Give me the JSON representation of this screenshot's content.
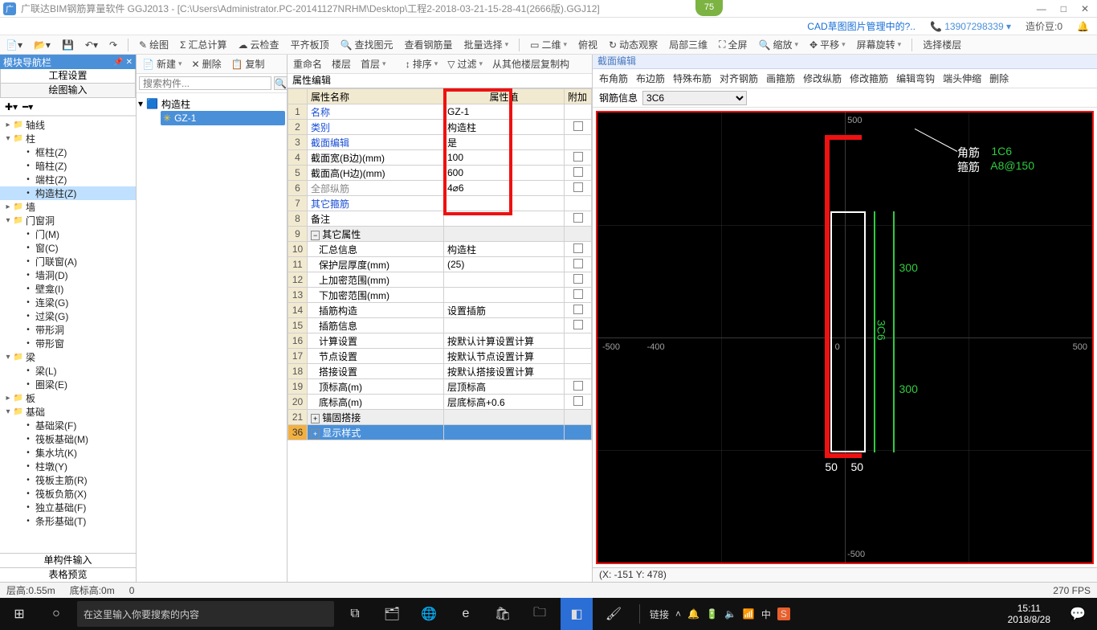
{
  "titlebar": {
    "app_icon_letter": "广",
    "title": "广联达BIM钢筋算量软件 GGJ2013 - [C:\\Users\\Administrator.PC-20141127NRHM\\Desktop\\工程2-2018-03-21-15-28-41(2666版).GGJ12]",
    "min": "—",
    "max": "□",
    "close": "✕"
  },
  "badge75": "75",
  "infobar": {
    "cad": "CAD草图图片管理中的?..",
    "phone": "13907298339",
    "cost": "造价豆:0"
  },
  "toolbar1": [
    "绘图",
    "汇总计算",
    "云检查",
    "平齐板顶",
    "查找图元",
    "查看钢筋量",
    "批量选择"
  ],
  "toolbar1b": [
    "二维",
    "俯视",
    "动态观察",
    "局部三维",
    "全屏",
    "缩放",
    "平移",
    "屏幕旋转",
    "选择楼层"
  ],
  "nav": {
    "title": "模块导航栏",
    "tabs": {
      "a": "工程设置",
      "b": "绘图输入"
    },
    "tree": [
      {
        "t": "▸",
        "d": 0,
        "ic": "📁",
        "l": "轴线"
      },
      {
        "t": "▾",
        "d": 0,
        "ic": "📁",
        "l": "柱"
      },
      {
        "t": "",
        "d": 1,
        "ic": "",
        "l": "框柱(Z)"
      },
      {
        "t": "",
        "d": 1,
        "ic": "",
        "l": "暗柱(Z)"
      },
      {
        "t": "",
        "d": 1,
        "ic": "",
        "l": "端柱(Z)"
      },
      {
        "t": "",
        "d": 1,
        "ic": "",
        "l": "构造柱(Z)",
        "sel": true
      },
      {
        "t": "▸",
        "d": 0,
        "ic": "📁",
        "l": "墙"
      },
      {
        "t": "▾",
        "d": 0,
        "ic": "📁",
        "l": "门窗洞"
      },
      {
        "t": "",
        "d": 1,
        "ic": "",
        "l": "门(M)"
      },
      {
        "t": "",
        "d": 1,
        "ic": "",
        "l": "窗(C)"
      },
      {
        "t": "",
        "d": 1,
        "ic": "",
        "l": "门联窗(A)"
      },
      {
        "t": "",
        "d": 1,
        "ic": "",
        "l": "墙洞(D)"
      },
      {
        "t": "",
        "d": 1,
        "ic": "",
        "l": "壁龛(I)"
      },
      {
        "t": "",
        "d": 1,
        "ic": "",
        "l": "连梁(G)"
      },
      {
        "t": "",
        "d": 1,
        "ic": "",
        "l": "过梁(G)"
      },
      {
        "t": "",
        "d": 1,
        "ic": "",
        "l": "带形洞"
      },
      {
        "t": "",
        "d": 1,
        "ic": "",
        "l": "带形窗"
      },
      {
        "t": "▾",
        "d": 0,
        "ic": "📁",
        "l": "梁"
      },
      {
        "t": "",
        "d": 1,
        "ic": "",
        "l": "梁(L)"
      },
      {
        "t": "",
        "d": 1,
        "ic": "",
        "l": "圈梁(E)"
      },
      {
        "t": "▸",
        "d": 0,
        "ic": "📁",
        "l": "板"
      },
      {
        "t": "▾",
        "d": 0,
        "ic": "📁",
        "l": "基础"
      },
      {
        "t": "",
        "d": 1,
        "ic": "",
        "l": "基础梁(F)"
      },
      {
        "t": "",
        "d": 1,
        "ic": "",
        "l": "筏板基础(M)"
      },
      {
        "t": "",
        "d": 1,
        "ic": "",
        "l": "集水坑(K)"
      },
      {
        "t": "",
        "d": 1,
        "ic": "",
        "l": "柱墩(Y)"
      },
      {
        "t": "",
        "d": 1,
        "ic": "",
        "l": "筏板主筋(R)"
      },
      {
        "t": "",
        "d": 1,
        "ic": "",
        "l": "筏板负筋(X)"
      },
      {
        "t": "",
        "d": 1,
        "ic": "",
        "l": "独立基础(F)"
      },
      {
        "t": "",
        "d": 1,
        "ic": "",
        "l": "条形基础(T)"
      }
    ],
    "bottom": [
      "单构件输入",
      "表格预览"
    ]
  },
  "comp": {
    "tb": [
      "新建",
      "删除",
      "复制",
      "重命名",
      "楼层",
      "首层"
    ],
    "tb2": [
      "排序",
      "过滤",
      "从其他楼层复制构"
    ],
    "search_ph": "搜索构件...",
    "root": "构造柱",
    "item": "GZ-1"
  },
  "props": {
    "title": "属性编辑",
    "cols": {
      "name": "属性名称",
      "val": "属性值",
      "add": "附加"
    },
    "rows": [
      {
        "n": "1",
        "k": "名称",
        "v": "GZ-1",
        "blue": true
      },
      {
        "n": "2",
        "k": "类别",
        "v": "构造柱",
        "blue": true,
        "chk": true
      },
      {
        "n": "3",
        "k": "截面编辑",
        "v": "是",
        "blue": true
      },
      {
        "n": "4",
        "k": "截面宽(B边)(mm)",
        "v": "100",
        "chk": true
      },
      {
        "n": "5",
        "k": "截面高(H边)(mm)",
        "v": "600",
        "chk": true
      },
      {
        "n": "6",
        "k": "全部纵筋",
        "v": "4⌀6",
        "grey": true,
        "chk": true
      },
      {
        "n": "7",
        "k": "其它箍筋",
        "v": "",
        "blue": true
      },
      {
        "n": "8",
        "k": "备注",
        "v": "",
        "chk": true
      },
      {
        "n": "9",
        "k": "其它属性",
        "v": "",
        "grp": true,
        "exp": "−"
      },
      {
        "n": "10",
        "k": "汇总信息",
        "v": "构造柱",
        "ind": true,
        "chk": true
      },
      {
        "n": "11",
        "k": "保护层厚度(mm)",
        "v": "(25)",
        "ind": true,
        "chk": true
      },
      {
        "n": "12",
        "k": "上加密范围(mm)",
        "v": "",
        "ind": true,
        "chk": true
      },
      {
        "n": "13",
        "k": "下加密范围(mm)",
        "v": "",
        "ind": true,
        "chk": true
      },
      {
        "n": "14",
        "k": "插筋构造",
        "v": "设置插筋",
        "ind": true,
        "chk": true
      },
      {
        "n": "15",
        "k": "插筋信息",
        "v": "",
        "ind": true,
        "chk": true
      },
      {
        "n": "16",
        "k": "计算设置",
        "v": "按默认计算设置计算",
        "ind": true
      },
      {
        "n": "17",
        "k": "节点设置",
        "v": "按默认节点设置计算",
        "ind": true
      },
      {
        "n": "18",
        "k": "搭接设置",
        "v": "按默认搭接设置计算",
        "ind": true
      },
      {
        "n": "19",
        "k": "顶标高(m)",
        "v": "层顶标高",
        "ind": true,
        "chk": true
      },
      {
        "n": "20",
        "k": "底标高(m)",
        "v": "层底标高+0.6",
        "ind": true,
        "chk": true
      },
      {
        "n": "21",
        "k": "锚固搭接",
        "v": "",
        "grp": true,
        "exp": "+"
      },
      {
        "n": "36",
        "k": "显示样式",
        "v": "",
        "grp": true,
        "exp": "+",
        "sel": true
      }
    ]
  },
  "canvas": {
    "title": "截面编辑",
    "tabs": [
      "布角筋",
      "布边筋",
      "特殊布筋",
      "对齐钢筋",
      "画箍筋",
      "修改纵筋",
      "修改箍筋",
      "编辑弯钩",
      "端头伸缩",
      "删除"
    ],
    "rebar_lbl": "钢筋信息",
    "rebar_val": "3C6",
    "labels": {
      "jiao": "角筋",
      "gu": "箍筋",
      "jiao_v": "1C6",
      "gu_v": "A8@150",
      "side": "3C6",
      "d1": "300",
      "d2": "300",
      "b1": "50",
      "b2": "50"
    },
    "xy": "(X: -151 Y: 478)"
  },
  "status": {
    "a": "层高:0.55m",
    "b": "底标高:0m",
    "c": "0",
    "fps": "270 FPS"
  },
  "taskbar": {
    "search_ph": "在这里输入你要搜索的内容",
    "link": "链接",
    "time": "15:11",
    "date": "2018/8/28",
    "ime": "中"
  }
}
